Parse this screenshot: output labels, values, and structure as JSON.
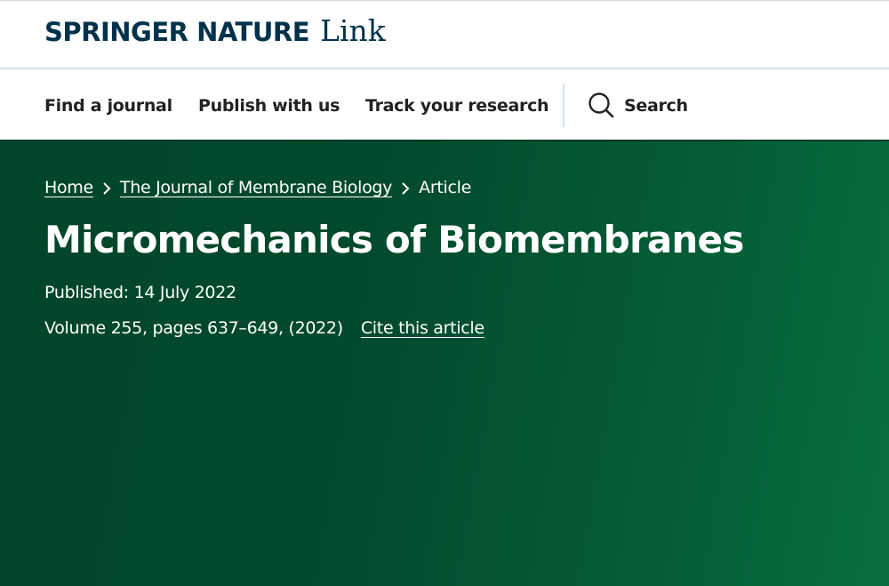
{
  "header": {
    "brand_main": "SPRINGER NATURE",
    "brand_sub": "Link"
  },
  "nav": {
    "items": [
      {
        "label": "Find a journal"
      },
      {
        "label": "Publish with us"
      },
      {
        "label": "Track your research"
      }
    ],
    "search_label": "Search"
  },
  "breadcrumb": {
    "home": "Home",
    "journal": "The Journal of Membrane Biology",
    "current": "Article"
  },
  "article": {
    "title": "Micromechanics of Biomembranes",
    "published": "Published: 14 July 2022",
    "volume_pages": "Volume 255, pages 637–649, (2022)",
    "cite_label": "Cite this article"
  },
  "colors": {
    "brand_navy": "#01324b",
    "hero_green_dark": "#01452a",
    "hero_green_light": "#096f3f",
    "nav_text": "#222222",
    "divider": "#d4e3ec"
  },
  "icons": {
    "search": "search-icon",
    "breadcrumb_separator": "chevron-right-icon"
  }
}
